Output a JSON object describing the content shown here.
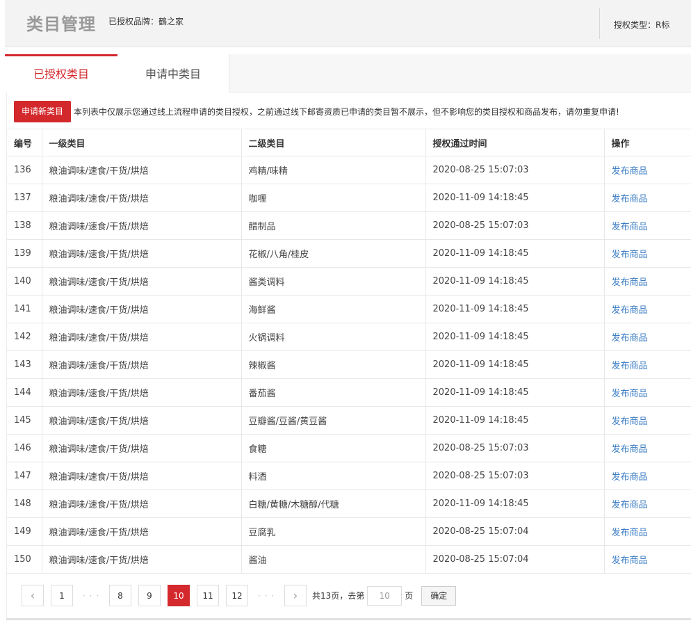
{
  "header": {
    "title": "类目管理",
    "brand_label": "已授权品牌：",
    "brand_name": "鶴之家",
    "auth_type_label": "授权类型：",
    "auth_type_value": "R标"
  },
  "tabs": [
    {
      "label": "已授权类目",
      "active": true
    },
    {
      "label": "申请中类目",
      "active": false
    }
  ],
  "notice": {
    "button_label": "申请新类目",
    "text": "本列表中仅展示您通过线上流程申请的类目授权，之前通过线下邮寄资质已申请的类目暂不展示，但不影响您的类目授权和商品发布，请勿重复申请!"
  },
  "table": {
    "columns": [
      "编号",
      "一级类目",
      "二级类目",
      "授权通过时间",
      "操作"
    ],
    "rows": [
      {
        "id": "136",
        "level1": "粮油调味/速食/干货/烘焙",
        "level2": "鸡精/味精",
        "time": "2020-08-25 15:07:03",
        "action": "发布商品"
      },
      {
        "id": "137",
        "level1": "粮油调味/速食/干货/烘焙",
        "level2": "咖喱",
        "time": "2020-11-09 14:18:45",
        "action": "发布商品"
      },
      {
        "id": "138",
        "level1": "粮油调味/速食/干货/烘焙",
        "level2": "醋制品",
        "time": "2020-08-25 15:07:03",
        "action": "发布商品"
      },
      {
        "id": "139",
        "level1": "粮油调味/速食/干货/烘焙",
        "level2": "花椒/八角/桂皮",
        "time": "2020-11-09 14:18:45",
        "action": "发布商品"
      },
      {
        "id": "140",
        "level1": "粮油调味/速食/干货/烘焙",
        "level2": "酱类调料",
        "time": "2020-11-09 14:18:45",
        "action": "发布商品"
      },
      {
        "id": "141",
        "level1": "粮油调味/速食/干货/烘焙",
        "level2": "海鲜酱",
        "time": "2020-11-09 14:18:45",
        "action": "发布商品"
      },
      {
        "id": "142",
        "level1": "粮油调味/速食/干货/烘焙",
        "level2": "火锅调料",
        "time": "2020-11-09 14:18:45",
        "action": "发布商品"
      },
      {
        "id": "143",
        "level1": "粮油调味/速食/干货/烘焙",
        "level2": "辣椒酱",
        "time": "2020-11-09 14:18:45",
        "action": "发布商品"
      },
      {
        "id": "144",
        "level1": "粮油调味/速食/干货/烘焙",
        "level2": "番茄酱",
        "time": "2020-11-09 14:18:45",
        "action": "发布商品"
      },
      {
        "id": "145",
        "level1": "粮油调味/速食/干货/烘焙",
        "level2": "豆瓣酱/豆酱/黄豆酱",
        "time": "2020-11-09 14:18:45",
        "action": "发布商品"
      },
      {
        "id": "146",
        "level1": "粮油调味/速食/干货/烘焙",
        "level2": "食糖",
        "time": "2020-08-25 15:07:03",
        "action": "发布商品"
      },
      {
        "id": "147",
        "level1": "粮油调味/速食/干货/烘焙",
        "level2": "料酒",
        "time": "2020-08-25 15:07:03",
        "action": "发布商品"
      },
      {
        "id": "148",
        "level1": "粮油调味/速食/干货/烘焙",
        "level2": "白糖/黄糖/木糖醇/代糖",
        "time": "2020-11-09 14:18:45",
        "action": "发布商品"
      },
      {
        "id": "149",
        "level1": "粮油调味/速食/干货/烘焙",
        "level2": "豆腐乳",
        "time": "2020-08-25 15:07:04",
        "action": "发布商品"
      },
      {
        "id": "150",
        "level1": "粮油调味/速食/干货/烘焙",
        "level2": "酱油",
        "time": "2020-08-25 15:07:04",
        "action": "发布商品"
      }
    ]
  },
  "pagination": {
    "prev_icon": "chevron-left-icon",
    "next_icon": "chevron-right-icon",
    "first": "1",
    "ellipsis": "· · ·",
    "pages": [
      "8",
      "9",
      "10",
      "11",
      "12"
    ],
    "current": "10",
    "total_text": "共13页，去第",
    "input_value": "10",
    "unit": "页",
    "confirm_label": "确定"
  },
  "colors": {
    "accent": "#d3282c",
    "link": "#3b7dc4"
  }
}
